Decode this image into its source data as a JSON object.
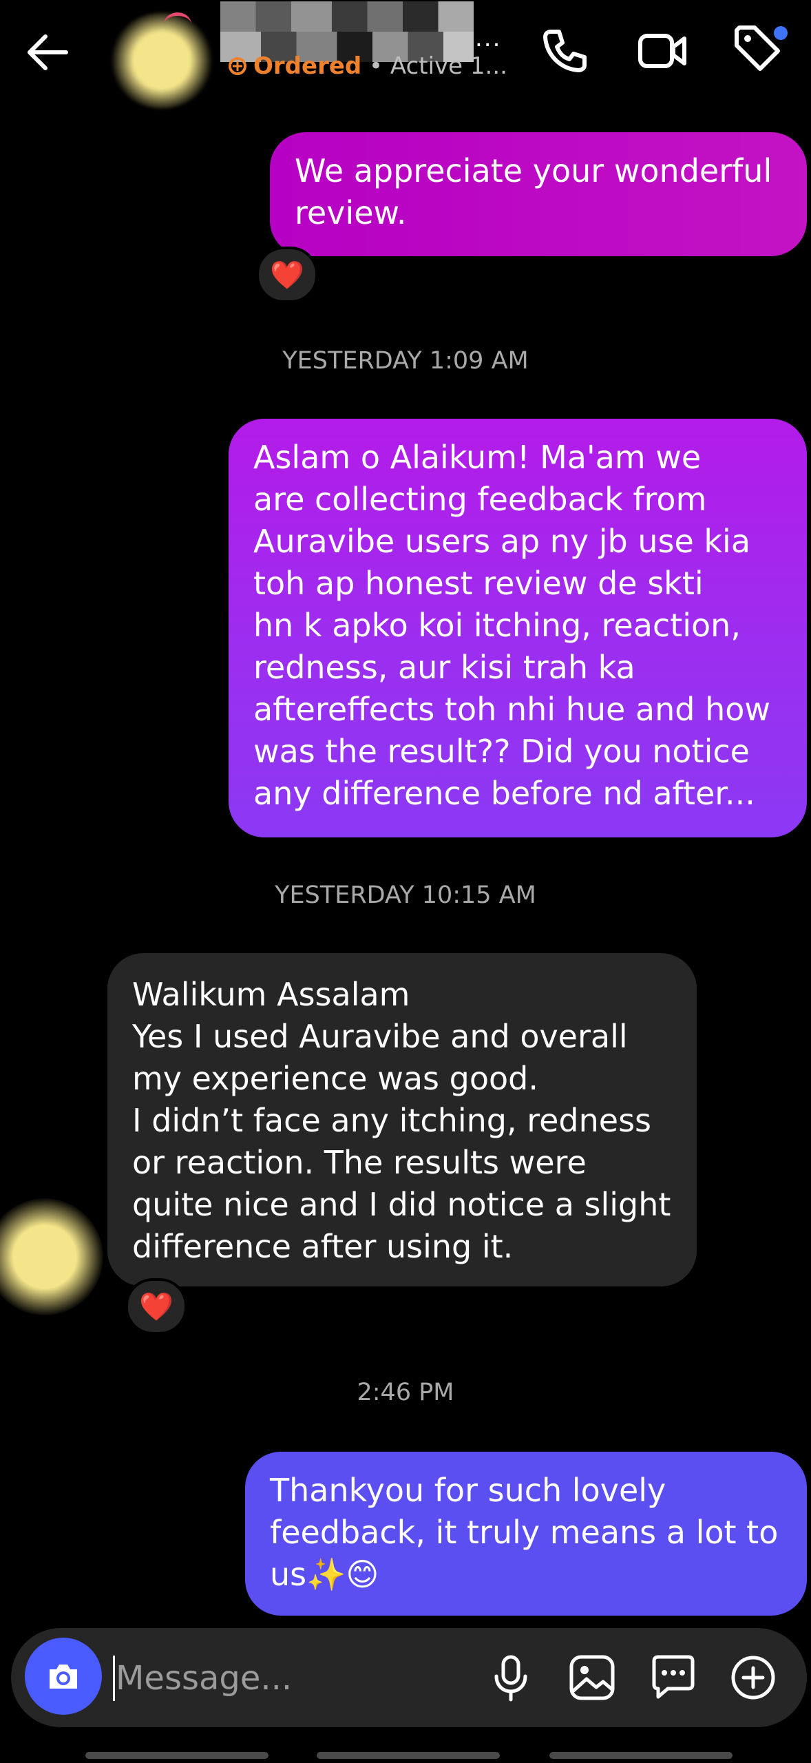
{
  "header": {
    "back_icon": "arrow-left-icon",
    "name_suffix": "...",
    "status_label": "Ordered",
    "active_text": "• Active 1...",
    "icons": [
      "phone-icon",
      "video-icon",
      "tag-icon"
    ]
  },
  "messages": [
    {
      "sender": "me",
      "text": "We appreciate your wonderful\nreview.",
      "reaction": "❤️"
    },
    {
      "timestamp": "YESTERDAY 1:09 AM"
    },
    {
      "sender": "me",
      "text": "Aslam o Alaikum! Ma'am we\nare collecting feedback from\nAuravibe users ap ny jb use kia\ntoh ap honest review de skti\nhn k apko koi itching, reaction,\nredness, aur kisi trah ka\naftereffects toh nhi hue and how\nwas the result?? Did you notice\nany difference before nd after..."
    },
    {
      "timestamp": "YESTERDAY 10:15 AM"
    },
    {
      "sender": "them",
      "text": "Walikum Assalam\nYes I used Auravibe and overall\nmy experience was good.\nI didn’t face any itching, redness\nor reaction. The results were\nquite nice and I did notice a slight\ndifference after using it.",
      "reaction": "❤️"
    },
    {
      "timestamp": "2:46 PM"
    },
    {
      "sender": "me",
      "text": "Thankyou for such lovely\nfeedback, it truly means a lot to\nus✨😊"
    }
  ],
  "composer": {
    "placeholder": "Message...",
    "icons": [
      "camera-icon",
      "microphone-icon",
      "gallery-icon",
      "sticker-icon",
      "plus-icon"
    ]
  },
  "colors": {
    "bubble_1": "#c010c4",
    "bubble_2": "#a02cf0",
    "bubble_3": "#262626",
    "bubble_4": "#5b4ff2",
    "camera": "#4a5bff",
    "ordered": "#f0822d"
  }
}
